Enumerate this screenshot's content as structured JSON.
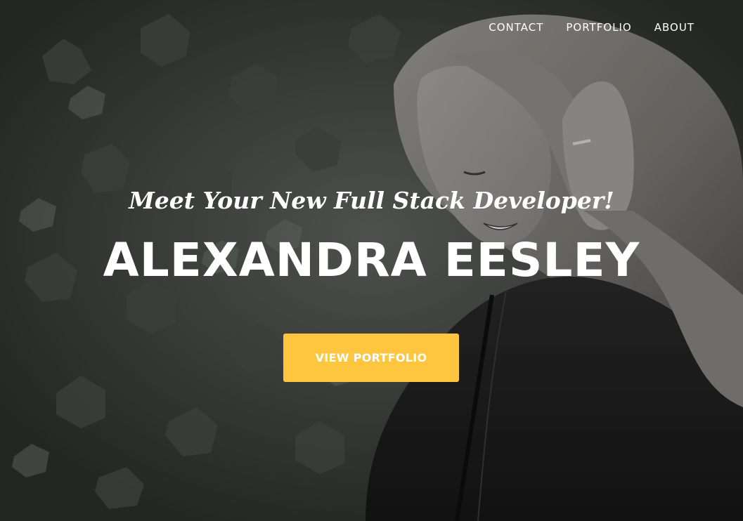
{
  "nav": {
    "items": [
      {
        "label": "CONTACT"
      },
      {
        "label": "PORTFOLIO"
      },
      {
        "label": "ABOUT"
      }
    ]
  },
  "hero": {
    "subtitle": "Meet Your New Full Stack Developer!",
    "name": "ALEXANDRA EESLEY",
    "cta_label": "VIEW PORTFOLIO",
    "background": "black-and-white-photo-woman-with-ivy-wall"
  },
  "colors": {
    "accent": "#fec63f",
    "text": "#ffffff",
    "overlay": "#1b1d1b"
  }
}
